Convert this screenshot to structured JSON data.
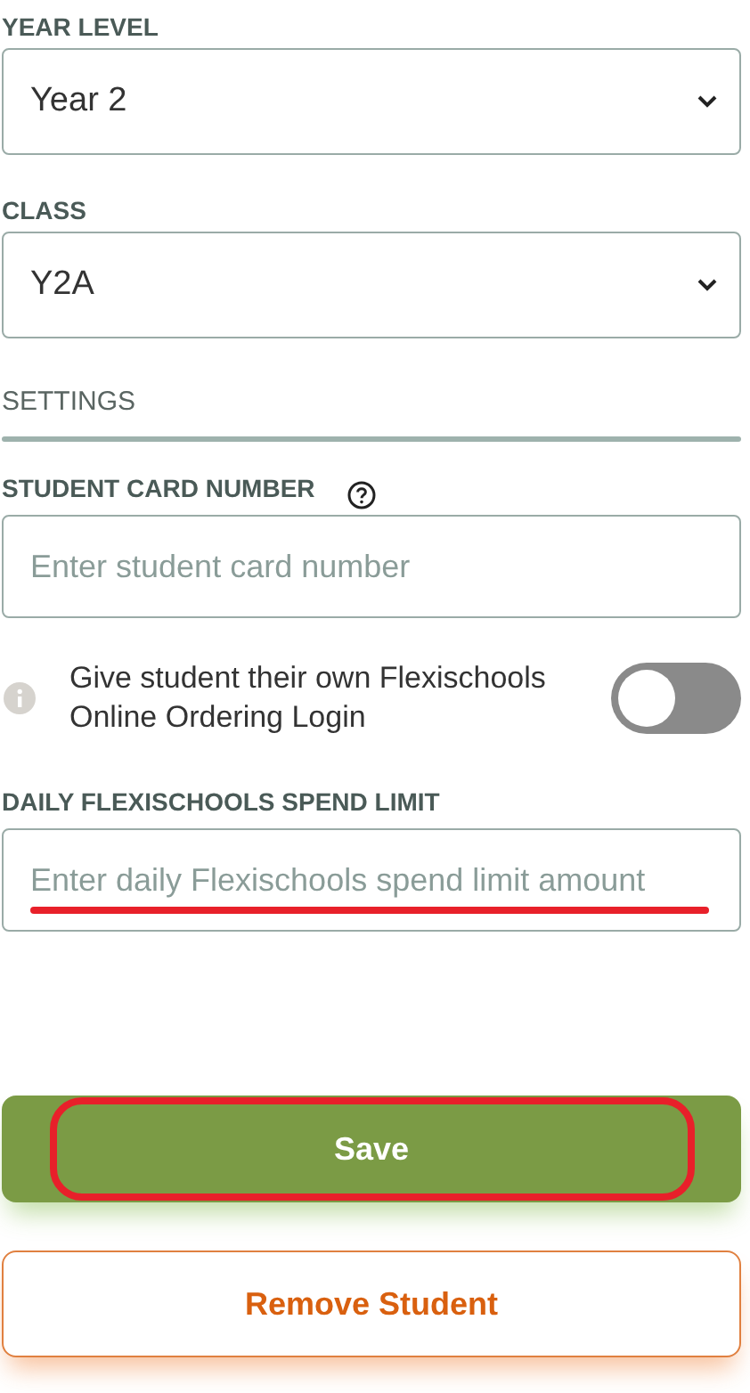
{
  "selects": [
    {
      "label": "YEAR LEVEL",
      "value": "Year 2"
    },
    {
      "label": "CLASS",
      "value": "Y2A"
    }
  ],
  "settings": {
    "heading": "SETTINGS",
    "card_number": {
      "label": "STUDENT CARD NUMBER",
      "placeholder": "Enter student card number"
    },
    "login_toggle": {
      "text": "Give student their own Flexischools Online Ordering Login",
      "on": false
    },
    "spend_limit": {
      "label": "DAILY FLEXISCHOOLS SPEND LIMIT",
      "placeholder": "Enter daily Flexischools spend limit amount",
      "marked": true
    }
  },
  "buttons": [
    {
      "kind": "primary",
      "label": "Save",
      "marked": true
    },
    {
      "kind": "danger-outline",
      "label": "Remove Student",
      "marked": false
    }
  ]
}
